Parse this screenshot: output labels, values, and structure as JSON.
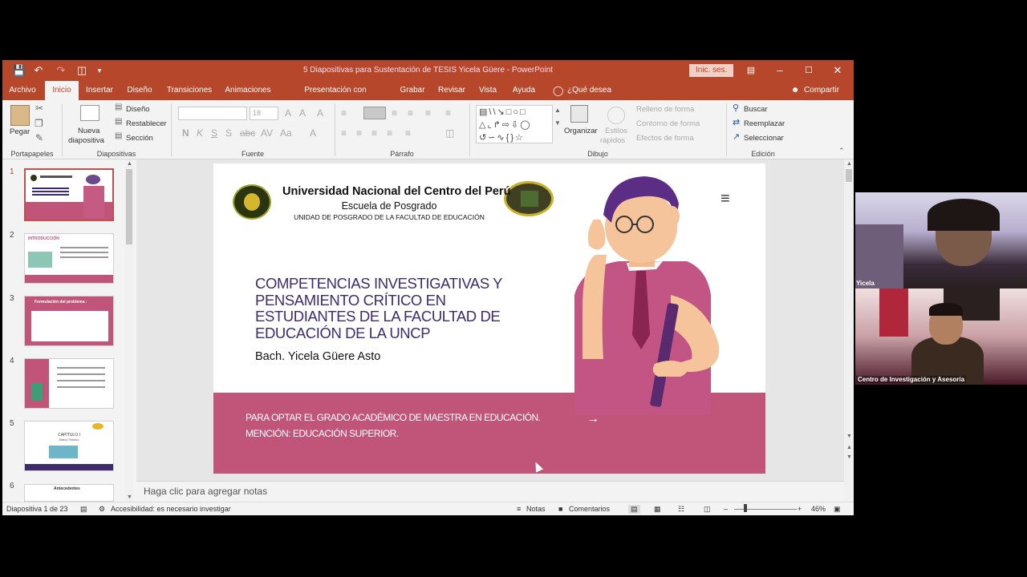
{
  "window": {
    "title": "5 Diapositivas para Sustentación de TESIS Yicela Güere  -  PowerPoint",
    "signin": "Inic. ses."
  },
  "tabs": [
    "Archivo",
    "Inicio",
    "Insertar",
    "Diseño",
    "Transiciones",
    "Animaciones",
    "Presentación con diapositivas",
    "Grabar",
    "Revisar",
    "Vista",
    "Ayuda",
    "¿Qué desea hacer?"
  ],
  "share": "Compartir",
  "ribbon": {
    "paste": "Pegar",
    "new_slide_1": "Nueva",
    "new_slide_2": "diapositiva",
    "layout": "Diseño",
    "reset": "Restablecer",
    "section": "Sección",
    "font_size": "18",
    "arrange": "Organizar",
    "quick_styles_1": "Estilos",
    "quick_styles_2": "rápidos",
    "shape_fill": "Relleno de forma",
    "shape_outline": "Contorno de forma",
    "shape_effects": "Efectos de forma",
    "find": "Buscar",
    "replace": "Reemplazar",
    "select": "Seleccionar",
    "groups": {
      "clipboard": "Portapapeles",
      "slides": "Diapositivas",
      "font": "Fuente",
      "paragraph": "Párrafo",
      "drawing": "Dibujo",
      "editing": "Edición"
    }
  },
  "thumbnails": [
    "1",
    "2",
    "3",
    "4",
    "5",
    "6"
  ],
  "thumb_texts": {
    "t2": "INTRODUCCIÓN",
    "t3": "Formulación del problema :",
    "t5_title": "CAPÍTULO I",
    "t5_sub": "Marco Teórico",
    "t6": "Antecedentes"
  },
  "slide": {
    "university": "Universidad Nacional del Centro del Perú",
    "school": "Escuela de Posgrado",
    "unit": "UNIDAD DE POSGRADO DE LA FACULTAD DE EDUCACIÓN",
    "title_lines": [
      "COMPETENCIAS INVESTIGATIVAS Y",
      "PENSAMIENTO CRÍTICO EN",
      "ESTUDIANTES DE LA FACULTAD DE",
      "EDUCACIÓN DE LA UNCP"
    ],
    "author": "Bach. Yicela Güere Asto",
    "footer_1": "PARA OPTAR EL GRADO  ACADÉMICO DE MAESTRA EN EDUCACIÓN.",
    "footer_2": "MENCIÓN: EDUCACIÓN SUPERIOR.",
    "arrow": "→",
    "accent_color": "#c05479",
    "title_color": "#3e2b6e"
  },
  "notes_placeholder": "Haga clic para agregar notas",
  "status": {
    "slide_counter": "Diapositiva 1 de 23",
    "accessibility": "Accesibilidad: es necesario investigar",
    "notes": "Notas",
    "comments": "Comentarios",
    "zoom": "46%"
  },
  "participants": [
    {
      "name": "Yicela"
    },
    {
      "name": "Centro de Investigación y Asesoría"
    }
  ]
}
